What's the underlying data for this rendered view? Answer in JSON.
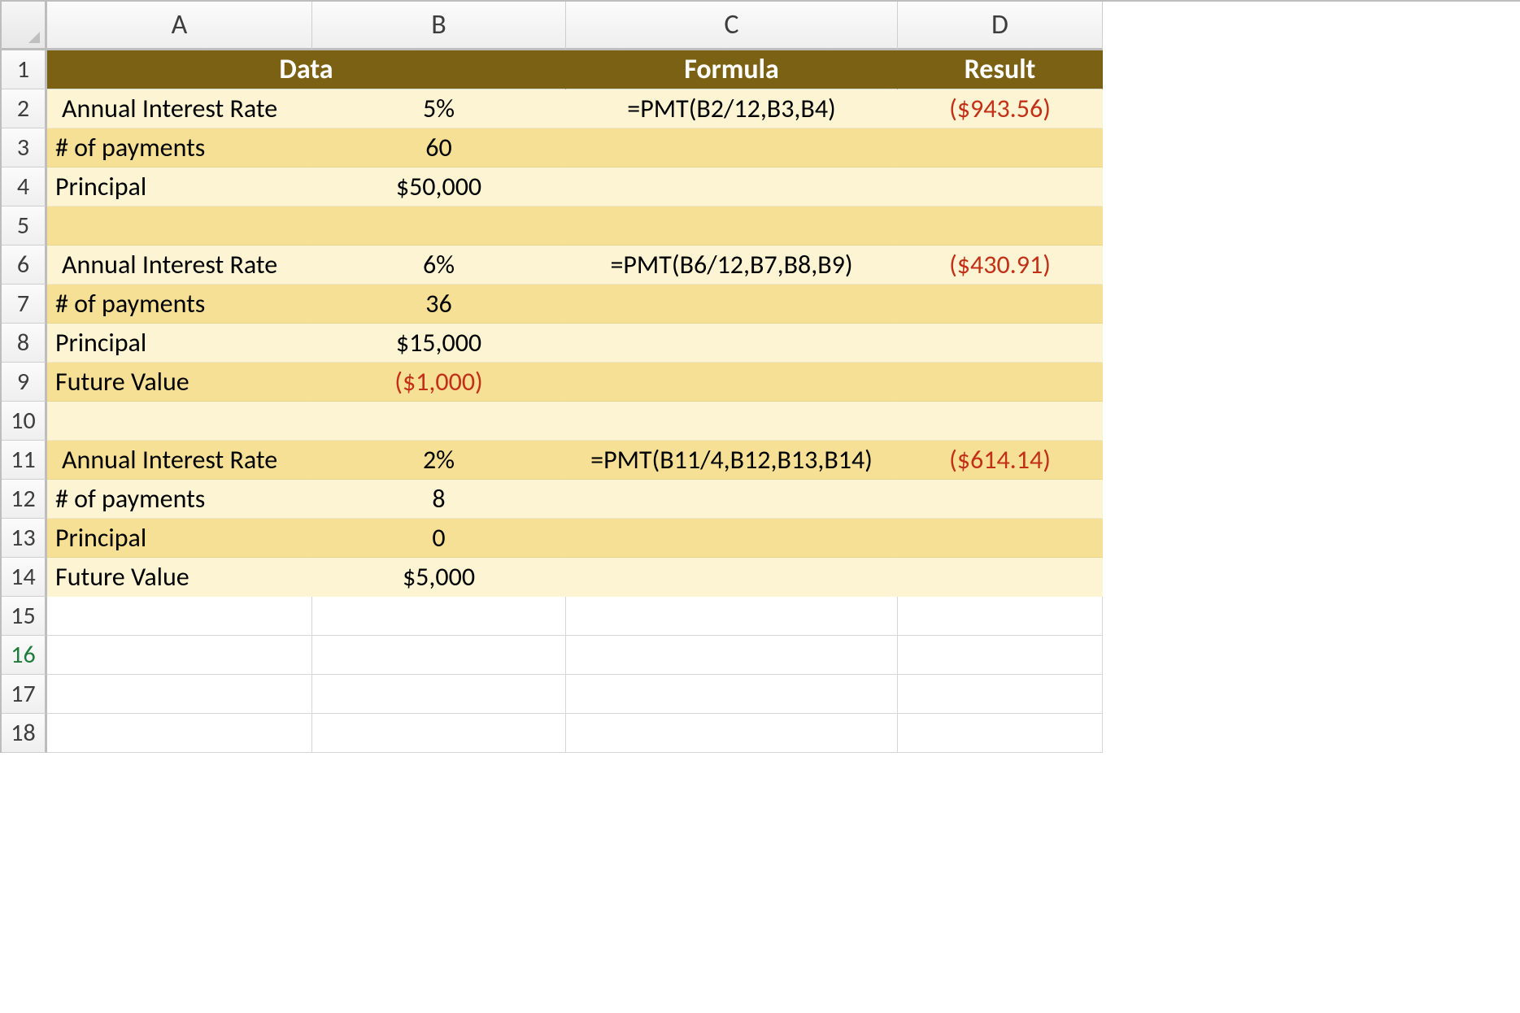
{
  "columns": {
    "A": "A",
    "B": "B",
    "C": "C",
    "D": "D"
  },
  "row_labels": {
    "r1": "1",
    "r2": "2",
    "r3": "3",
    "r4": "4",
    "r5": "5",
    "r6": "6",
    "r7": "7",
    "r8": "8",
    "r9": "9",
    "r10": "10",
    "r11": "11",
    "r12": "12",
    "r13": "13",
    "r14": "14",
    "r15": "15",
    "r16": "16",
    "r17": "17",
    "r18": "18"
  },
  "active_row": 16,
  "header": {
    "data": "Data",
    "formula": "Formula",
    "result": "Result"
  },
  "rows": {
    "r2": {
      "A": " Annual Interest Rate",
      "B": "5%",
      "C": "=PMT(B2/12,B3,B4)",
      "D": "($943.56)",
      "D_neg": true
    },
    "r3": {
      "A": "# of payments",
      "B": "60",
      "C": "",
      "D": ""
    },
    "r4": {
      "A": "Principal",
      "B": "$50,000",
      "C": "",
      "D": ""
    },
    "r5": {
      "A": "",
      "B": "",
      "C": "",
      "D": ""
    },
    "r6": {
      "A": " Annual Interest Rate",
      "B": "6%",
      "C": "=PMT(B6/12,B7,B8,B9)",
      "D": "($430.91)",
      "D_neg": true
    },
    "r7": {
      "A": "# of payments",
      "B": "36",
      "C": "",
      "D": ""
    },
    "r8": {
      "A": "Principal",
      "B": "$15,000",
      "C": "",
      "D": ""
    },
    "r9": {
      "A": "Future Value",
      "B": "($1,000)",
      "C": "",
      "D": "",
      "B_neg": true
    },
    "r10": {
      "A": "",
      "B": "",
      "C": "",
      "D": ""
    },
    "r11": {
      "A": " Annual Interest Rate",
      "B": "2%",
      "C": "=PMT(B11/4,B12,B13,B14)",
      "D": "($614.14)",
      "D_neg": true
    },
    "r12": {
      "A": "# of payments",
      "B": "8",
      "C": "",
      "D": ""
    },
    "r13": {
      "A": "Principal",
      "B": "0",
      "C": "",
      "D": ""
    },
    "r14": {
      "A": "Future Value",
      "B": "$5,000",
      "C": "",
      "D": ""
    }
  }
}
